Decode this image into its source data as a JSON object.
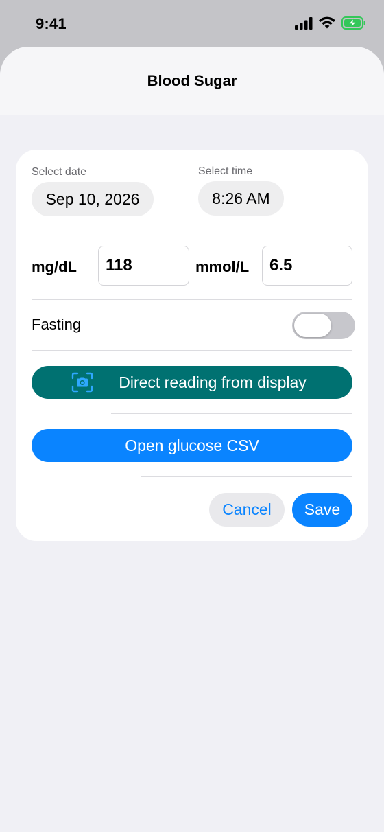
{
  "status_bar": {
    "time": "9:41",
    "icons": [
      "cellular-signal-icon",
      "wifi-icon",
      "battery-charging-icon"
    ],
    "battery_color": "#34c759"
  },
  "sheet": {
    "title": "Blood Sugar"
  },
  "form": {
    "date": {
      "label": "Select date",
      "value": "Sep 10, 2026"
    },
    "time": {
      "label": "Select time",
      "value": "8:26 AM"
    },
    "mgdl": {
      "label": "mg/dL",
      "value": "118"
    },
    "mmol": {
      "label": "mmol/L",
      "value": "6.5"
    },
    "fasting": {
      "label": "Fasting",
      "on": false
    },
    "scan_button": {
      "label": "Direct reading from display",
      "icon": "camera-scan-icon",
      "color": "#007171"
    },
    "csv_button": {
      "label": "Open glucose CSV",
      "color": "#0a84ff"
    },
    "cancel_label": "Cancel",
    "save_label": "Save"
  },
  "colors": {
    "accent": "#0a84ff",
    "scan_teal": "#007171",
    "background": "#f0f0f5"
  }
}
